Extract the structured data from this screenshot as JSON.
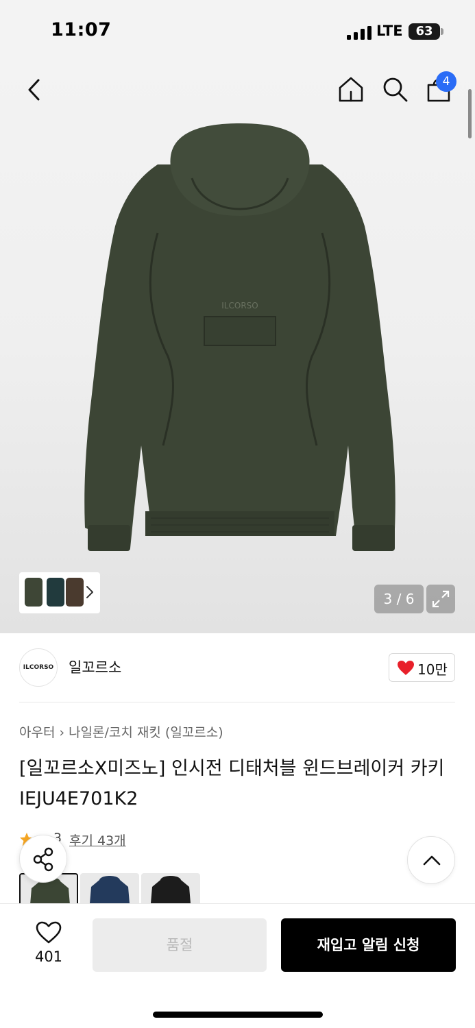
{
  "status_bar": {
    "time": "11:07",
    "network": "LTE",
    "battery": "63"
  },
  "nav": {
    "bag_count": "4"
  },
  "gallery": {
    "counter": "3 / 6",
    "image_icon": "khaki-windbreaker-back-view",
    "thumbnail_colors": [
      "#3e4636",
      "#213a3d",
      "#4a3a2e"
    ]
  },
  "brand": {
    "logo_text": "ILCORSO",
    "name": "일꼬르소",
    "likes": "10만"
  },
  "breadcrumb": {
    "category": "아우터",
    "subcategory": "나일론/코치 재킷 (일꼬르소)"
  },
  "product": {
    "title": "[일꼬르소X미즈노] 인시전 디태처블 윈드브레이커 카키 IEJU4E701K2",
    "rating": "3",
    "review_link": "후기 43개"
  },
  "color_options": [
    {
      "name": "khaki",
      "color": "#3b4534",
      "selected": true
    },
    {
      "name": "navy",
      "color": "#233a5c",
      "selected": false
    },
    {
      "name": "black",
      "color": "#1c1c1c",
      "selected": false
    }
  ],
  "actions": {
    "wishlist_count": "401",
    "soldout_label": "품절",
    "restock_label": "재입고 알림 신청"
  },
  "colors": {
    "accent_blue": "#2a6cf6",
    "heart_red": "#e8202a",
    "star": "#f5a623"
  }
}
